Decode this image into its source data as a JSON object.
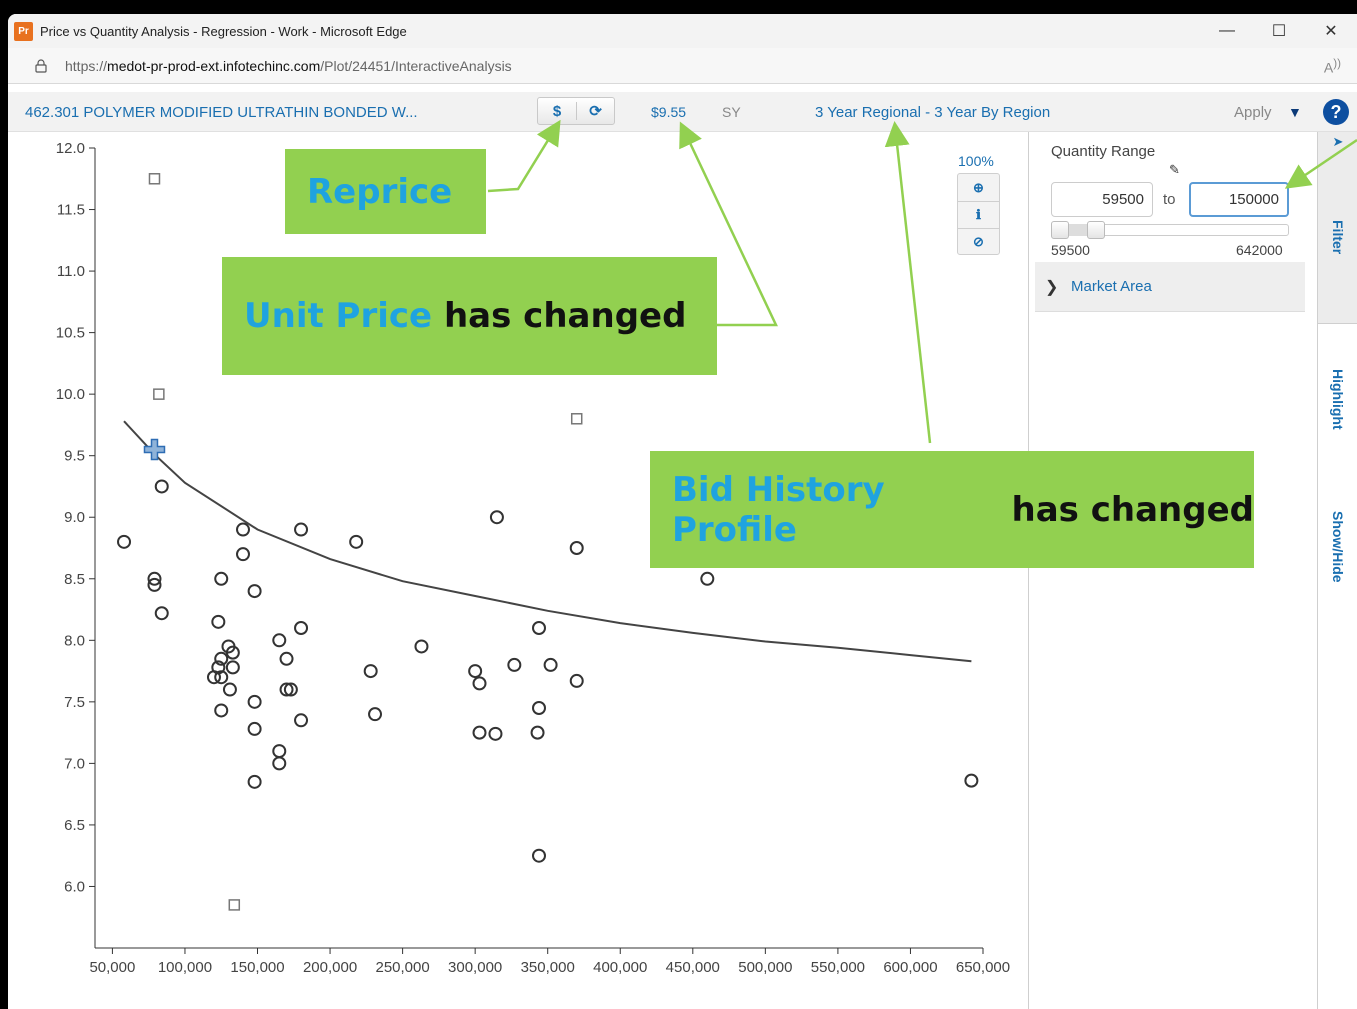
{
  "window": {
    "app_icon": "Pr",
    "title": "Price vs Quantity Analysis - Regression - Work - Microsoft Edge",
    "minimize": "—",
    "maximize": "☐",
    "close": "✕"
  },
  "address_bar": {
    "url_prefix": "https://",
    "url_host": "medot-pr-prod-ext.infotechinc.com",
    "url_path": "/Plot/24451/InteractiveAnalysis",
    "read_aloud_icon": "read-aloud-icon"
  },
  "toolbar": {
    "item_title": "462.301 POLYMER MODIFIED ULTRATHIN BONDED W...",
    "reprice_label": "$",
    "refresh_icon": "⟳",
    "unit_price": "$9.55",
    "unit": "SY",
    "bid_history_profile": "3 Year Regional - 3 Year By Region",
    "apply_label": "Apply",
    "apply_caret": "▼",
    "help_label": "?"
  },
  "zoom": {
    "level": "100%",
    "tools": [
      "zoom-in-icon",
      "info-icon",
      "reset-icon"
    ]
  },
  "filter_panel": {
    "quantity_range_label": "Quantity Range",
    "min_value": "59500",
    "to_label": "to",
    "max_value": "150000",
    "range_min_label": "59500",
    "range_max_label": "642000",
    "market_area_label": "Market Area"
  },
  "side_tabs": {
    "arrow": "➤",
    "filter": "Filter",
    "highlight": "Highlight",
    "show_hide": "Show/Hide"
  },
  "annotations": {
    "reprice": "Reprice",
    "unit_price_hl": "Unit Price",
    "unit_price_rest": " has changed",
    "bid_history_hl": "Bid History Profile",
    "bid_history_rest": " has changed"
  },
  "chart_data": {
    "type": "scatter",
    "x_tick_labels": [
      "50,000",
      "100,000",
      "150,000",
      "200,000",
      "250,000",
      "300,000",
      "350,000",
      "400,000",
      "450,000",
      "500,000",
      "550,000",
      "600,000",
      "650,000"
    ],
    "y_tick_labels": [
      "6.0",
      "6.5",
      "7.0",
      "7.5",
      "8.0",
      "8.5",
      "9.0",
      "9.5",
      "10.0",
      "10.5",
      "11.0",
      "11.5",
      "12.0"
    ],
    "xlim": [
      38000,
      650000
    ],
    "ylim": [
      5.5,
      12.0
    ],
    "points": [
      [
        58000,
        8.8
      ],
      [
        79000,
        8.5
      ],
      [
        79000,
        8.45
      ],
      [
        84000,
        9.25
      ],
      [
        84000,
        8.22
      ],
      [
        125000,
        8.5
      ],
      [
        123000,
        8.15
      ],
      [
        120000,
        7.7
      ],
      [
        125000,
        7.7
      ],
      [
        123000,
        7.78
      ],
      [
        125000,
        7.85
      ],
      [
        130000,
        7.95
      ],
      [
        133000,
        7.9
      ],
      [
        133000,
        7.78
      ],
      [
        131000,
        7.6
      ],
      [
        125000,
        7.43
      ],
      [
        140000,
        8.9
      ],
      [
        140000,
        8.7
      ],
      [
        148000,
        8.4
      ],
      [
        148000,
        7.5
      ],
      [
        148000,
        7.28
      ],
      [
        148000,
        6.85
      ],
      [
        165000,
        8.0
      ],
      [
        170000,
        7.85
      ],
      [
        170000,
        7.6
      ],
      [
        173000,
        7.6
      ],
      [
        165000,
        7.1
      ],
      [
        165000,
        7.0
      ],
      [
        180000,
        8.9
      ],
      [
        180000,
        8.1
      ],
      [
        180000,
        7.35
      ],
      [
        218000,
        8.8
      ],
      [
        228000,
        7.75
      ],
      [
        231000,
        7.4
      ],
      [
        263000,
        7.95
      ],
      [
        300000,
        7.75
      ],
      [
        303000,
        7.65
      ],
      [
        303000,
        7.25
      ],
      [
        314000,
        7.24
      ],
      [
        315000,
        9.0
      ],
      [
        327000,
        7.8
      ],
      [
        344000,
        8.1
      ],
      [
        344000,
        7.45
      ],
      [
        343000,
        7.25
      ],
      [
        344000,
        6.25
      ],
      [
        352000,
        7.8
      ],
      [
        370000,
        8.75
      ],
      [
        370000,
        7.67
      ],
      [
        460000,
        8.5
      ],
      [
        642000,
        6.86
      ]
    ],
    "excluded_points": [
      [
        79000,
        11.75
      ],
      [
        82000,
        10.0
      ],
      [
        370000,
        9.8
      ],
      [
        134000,
        5.85
      ]
    ],
    "selected_point": [
      79000,
      9.55
    ],
    "regression_curve": [
      [
        58000,
        9.78
      ],
      [
        80000,
        9.5
      ],
      [
        100000,
        9.28
      ],
      [
        150000,
        8.9
      ],
      [
        200000,
        8.66
      ],
      [
        250000,
        8.48
      ],
      [
        300000,
        8.36
      ],
      [
        350000,
        8.24
      ],
      [
        400000,
        8.14
      ],
      [
        450000,
        8.06
      ],
      [
        500000,
        7.99
      ],
      [
        550000,
        7.94
      ],
      [
        600000,
        7.88
      ],
      [
        642000,
        7.83
      ]
    ]
  }
}
